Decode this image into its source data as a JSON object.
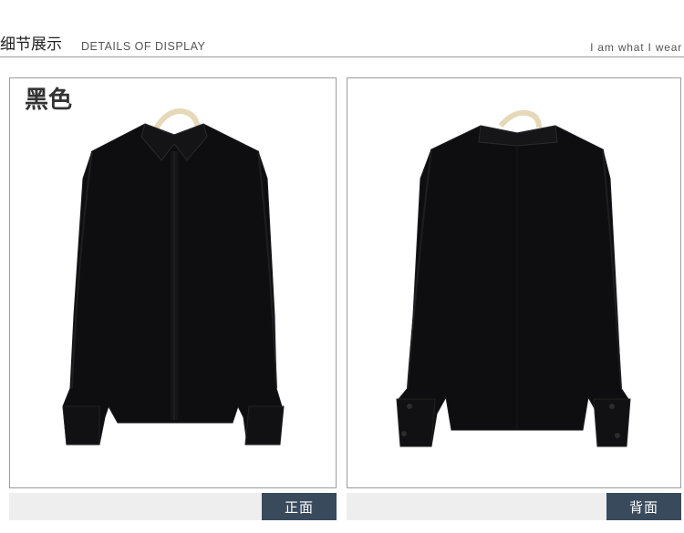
{
  "header": {
    "title_cn": "细节展示",
    "title_en": "DETAILS OF DISPLAY",
    "tagline": "I am what I wear"
  },
  "panels": {
    "front": {
      "color_label": "黑色",
      "view_label": "正面"
    },
    "back": {
      "view_label": "背面"
    }
  },
  "colors": {
    "shirt": "#0d0d0f",
    "tab": "#394a5d",
    "footer_bar": "#eeeeee",
    "rule": "#9a9a9a"
  }
}
